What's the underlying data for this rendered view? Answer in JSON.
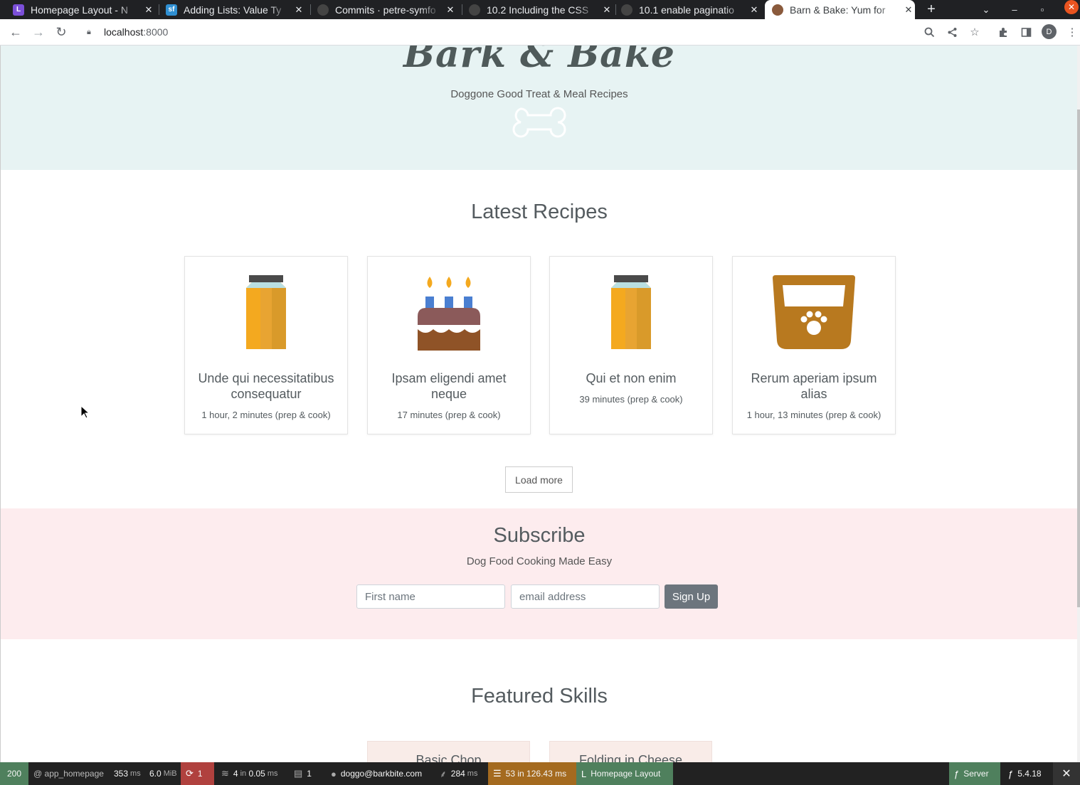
{
  "browser": {
    "tabs": [
      {
        "title": "Homepage Layout - N",
        "favicon": "notion-icon",
        "favcolor": "#7b4fd8",
        "active": false
      },
      {
        "title": "Adding Lists: Value Ty",
        "favicon": "symfonycasts-icon",
        "favcolor": "#2f8fd2",
        "active": false
      },
      {
        "title": "Commits · petre-symfo",
        "favicon": "github-icon",
        "favcolor": "#444",
        "active": false
      },
      {
        "title": "10.2 Including the CSS",
        "favicon": "github-icon",
        "favcolor": "#444",
        "active": false
      },
      {
        "title": "10.1 enable paginatio",
        "favicon": "globe-icon",
        "favcolor": "#444",
        "active": false
      },
      {
        "title": "Barn & Bake: Yum for",
        "favicon": "barkbake-icon",
        "favcolor": "#8a5a3c",
        "active": true
      }
    ],
    "url_host": "localhost",
    "url_port": ":8000",
    "avatar_letter": "D"
  },
  "hero": {
    "brand": "Bark & Bake",
    "tagline": "Doggone Good Treat & Meal Recipes"
  },
  "latest": {
    "title": "Latest Recipes",
    "recipes": [
      {
        "name": "Unde qui necessitatibus consequatur",
        "time": "1 hour, 2 minutes (prep & cook)",
        "icon": "jar-icon"
      },
      {
        "name": "Ipsam eligendi amet neque",
        "time": "17 minutes (prep & cook)",
        "icon": "cake-icon"
      },
      {
        "name": "Qui et non enim",
        "time": "39 minutes (prep & cook)",
        "icon": "jar-icon"
      },
      {
        "name": "Rerum aperiam ipsum alias",
        "time": "1 hour, 13 minutes (prep & cook)",
        "icon": "dog-bowl-icon"
      }
    ],
    "load_more": "Load more"
  },
  "subscribe": {
    "title": "Subscribe",
    "subtitle": "Dog Food Cooking Made Easy",
    "first_name_placeholder": "First name",
    "email_placeholder": "email address",
    "button": "Sign Up"
  },
  "skills": {
    "title": "Featured Skills",
    "items": [
      "Basic Chop",
      "Folding in Cheese"
    ]
  },
  "debug_toolbar": {
    "status": "200",
    "route": "@ app_homepage",
    "time_value": "353",
    "time_unit": "ms",
    "memory_value": "6.0",
    "memory_unit": "MiB",
    "errors": "1",
    "twig_value": "4",
    "twig_mid": "in",
    "twig_time": "0.05",
    "twig_unit": "ms",
    "translations": "1",
    "user": "doggo@barkbite.com",
    "init_value": "284",
    "init_unit": "ms",
    "db_value": "53",
    "db_mid": "in",
    "db_time": "126.43",
    "db_unit": "ms",
    "layout_label": "Homepage Layout",
    "server_label": "Server",
    "version": "5.4.18",
    "colors": {
      "status": "#4f805d",
      "errors": "#b0413e",
      "db": "#a46a1f",
      "layout": "#4f805d",
      "server": "#4f805d"
    }
  }
}
